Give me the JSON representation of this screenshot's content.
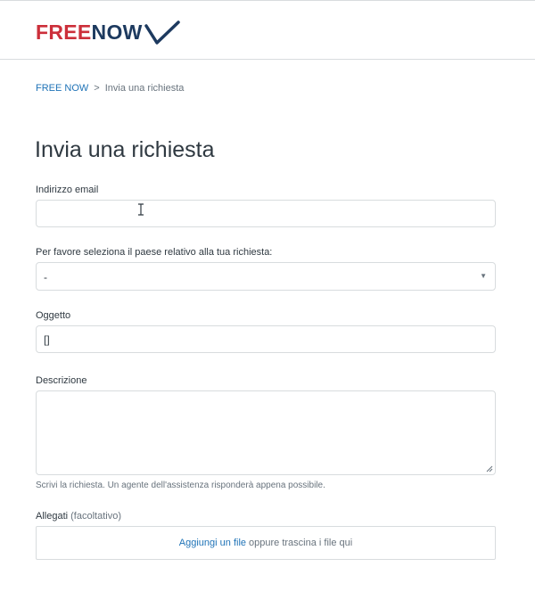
{
  "brand": {
    "part1": "FREE",
    "part2": "NOW",
    "color_red": "#cc2f3a",
    "color_navy": "#1d3a5f"
  },
  "breadcrumb": {
    "home": "FREE NOW",
    "separator": ">",
    "current": "Invia una richiesta"
  },
  "page": {
    "title": "Invia una richiesta"
  },
  "form": {
    "email": {
      "label": "Indirizzo email",
      "value": ""
    },
    "country": {
      "label": "Per favore seleziona il paese relativo alla tua richiesta:",
      "value": "-",
      "caret_icon": "chevron-down-icon"
    },
    "subject": {
      "label": "Oggetto",
      "value": "[]"
    },
    "description": {
      "label": "Descrizione",
      "value": "",
      "hint": "Scrivi la richiesta. Un agente dell'assistenza risponderà appena possibile."
    },
    "attachments": {
      "label": "Allegati",
      "optional": "(facoltativo)",
      "add_link": "Aggiungi un file",
      "drop_text": "oppure trascina i file qui"
    }
  },
  "colors": {
    "link": "#1f73b7",
    "border": "#d8dcde",
    "text": "#2f3941",
    "muted": "#68737d"
  }
}
